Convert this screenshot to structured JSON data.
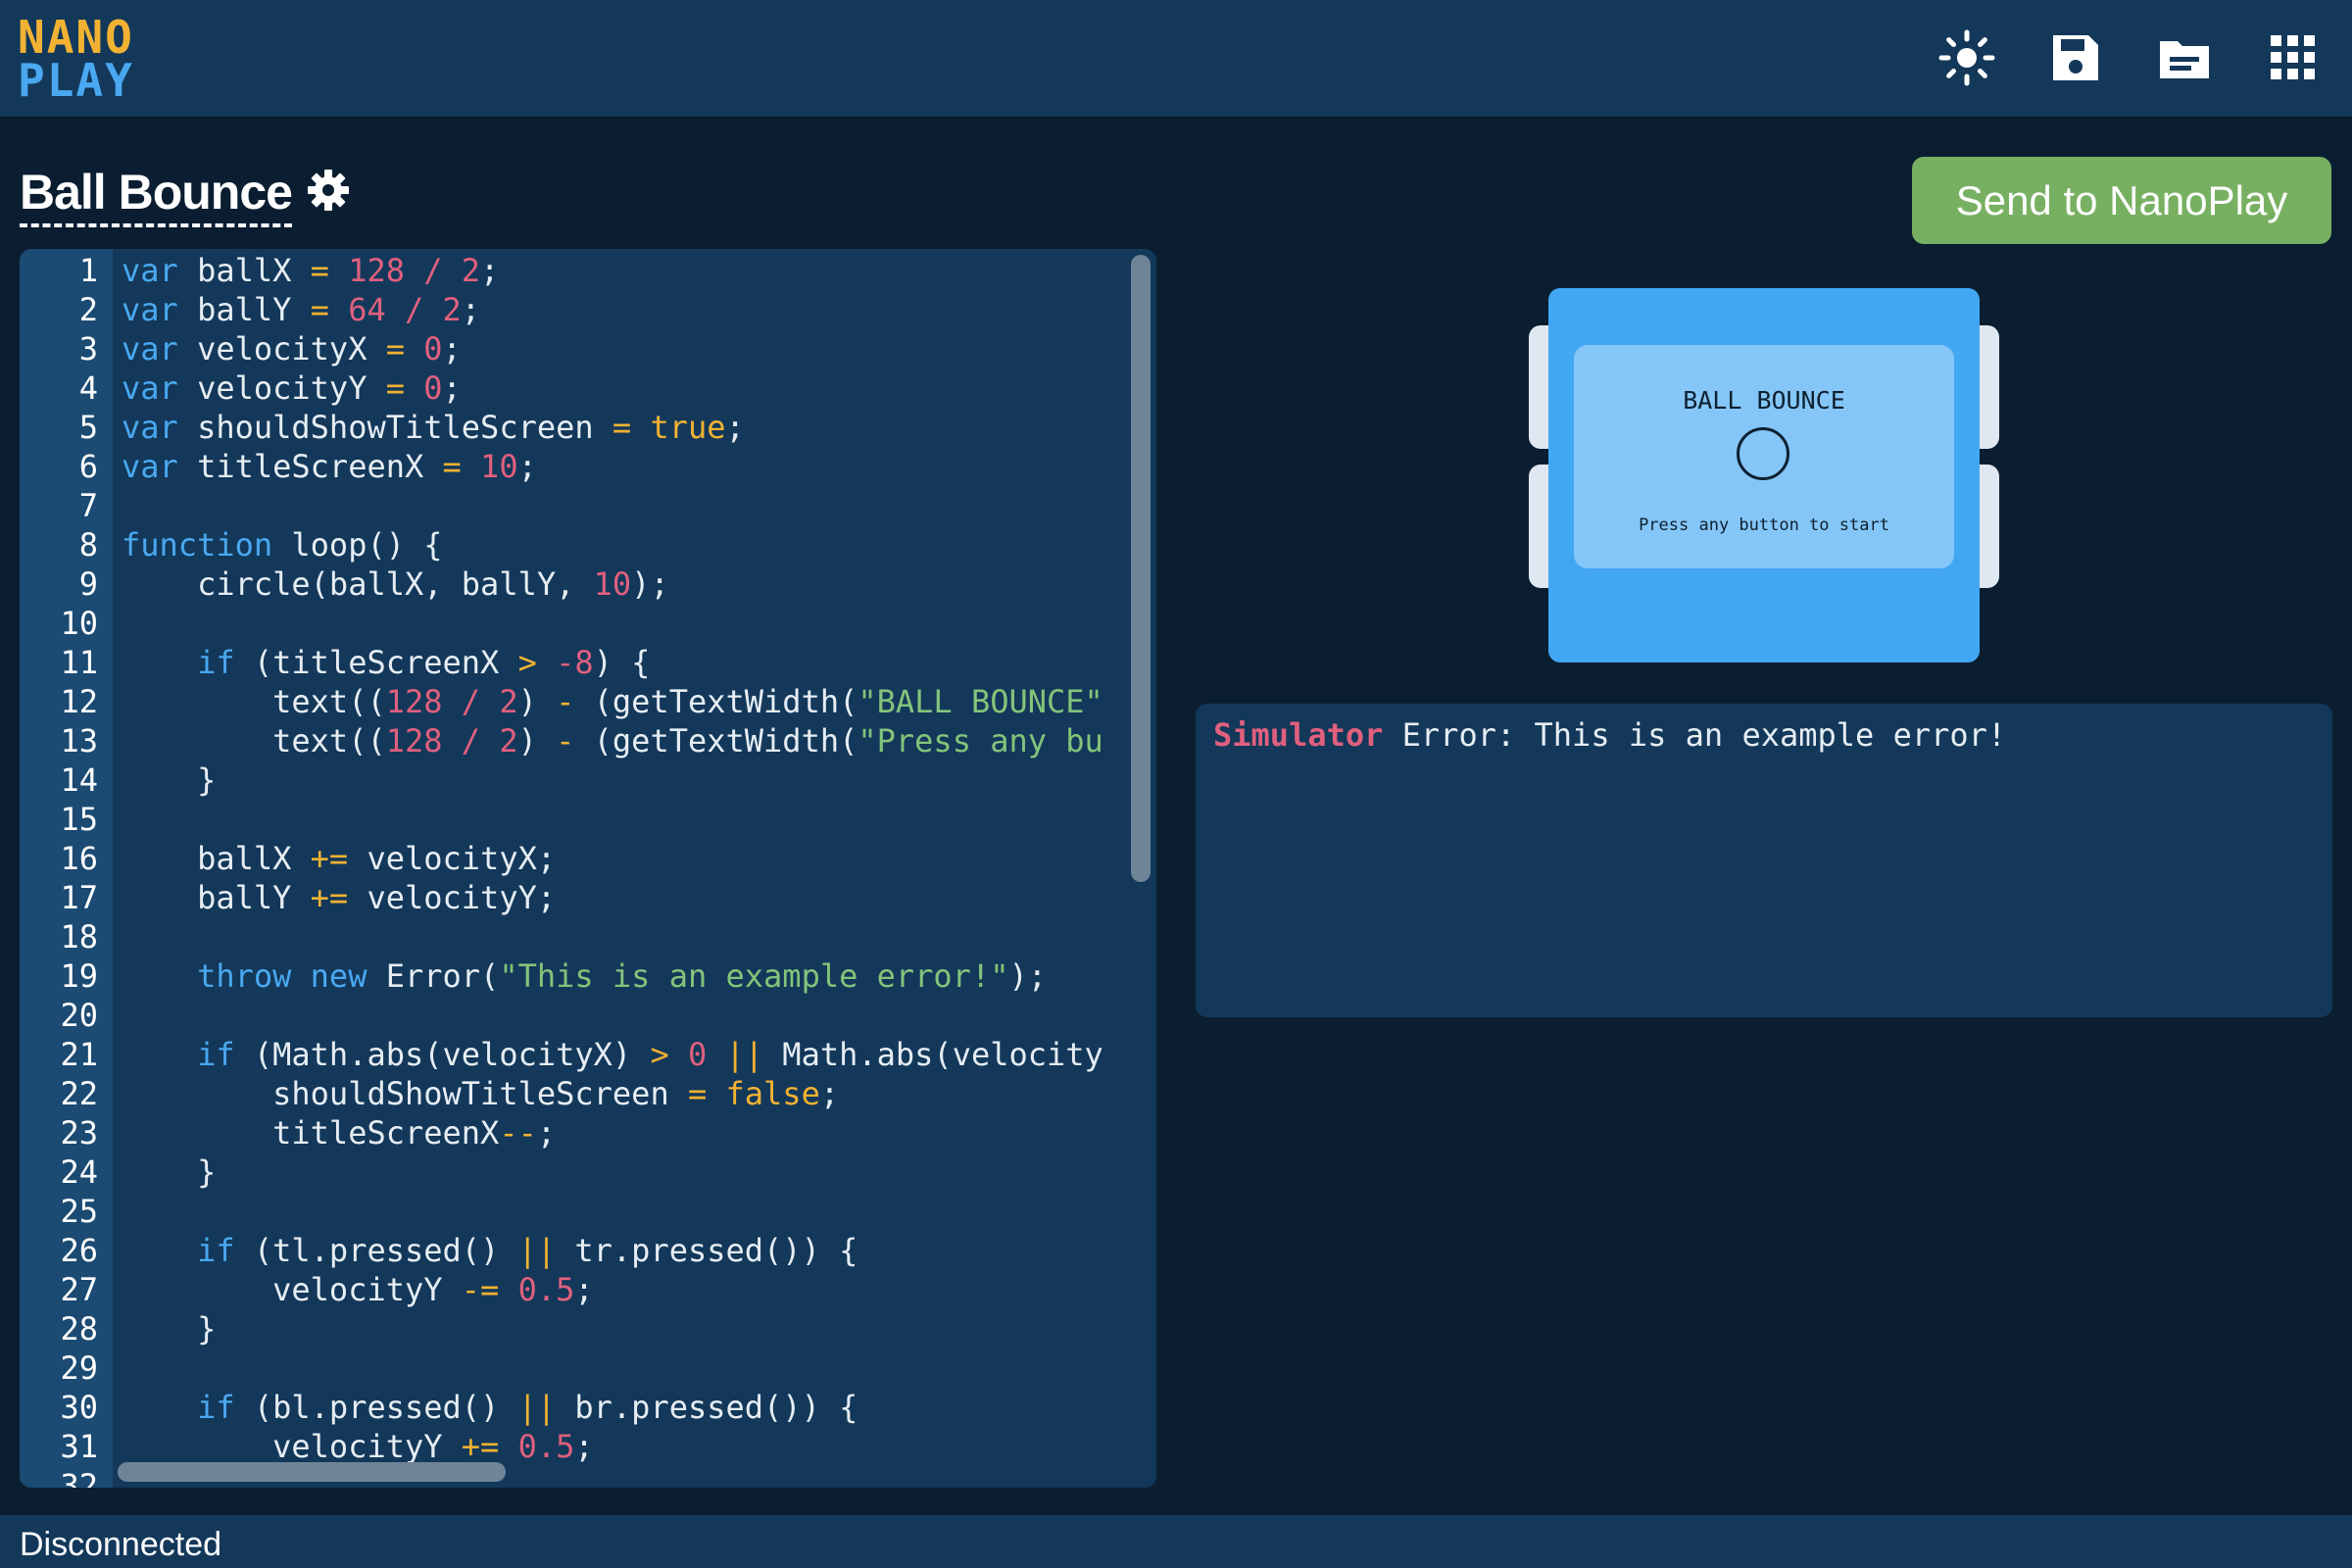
{
  "app": {
    "logo_line1": "NANO",
    "logo_line2": "PLAY",
    "toolbar_icons": [
      "sun-icon",
      "save-icon",
      "folder-icon",
      "grid-icon"
    ]
  },
  "project": {
    "title": "Ball Bounce",
    "send_button": "Send to NanoPlay"
  },
  "colors": {
    "background": "#0b1e31",
    "panel": "#13385a",
    "accent_blue": "#4aa8f0",
    "accent_orange": "#f2b233",
    "number_pink": "#e0607e",
    "string_green": "#83c47a",
    "send_green": "#78b062",
    "device_blue": "#42a7f2"
  },
  "editor": {
    "lines": [
      [
        [
          "kw",
          "var"
        ],
        [
          "t",
          " ballX "
        ],
        [
          "op",
          "="
        ],
        [
          "t",
          " "
        ],
        [
          "num",
          "128"
        ],
        [
          "t",
          " "
        ],
        [
          "num",
          "/"
        ],
        [
          "t",
          " "
        ],
        [
          "num",
          "2"
        ],
        [
          "t",
          ";"
        ]
      ],
      [
        [
          "kw",
          "var"
        ],
        [
          "t",
          " ballY "
        ],
        [
          "op",
          "="
        ],
        [
          "t",
          " "
        ],
        [
          "num",
          "64"
        ],
        [
          "t",
          " "
        ],
        [
          "num",
          "/"
        ],
        [
          "t",
          " "
        ],
        [
          "num",
          "2"
        ],
        [
          "t",
          ";"
        ]
      ],
      [
        [
          "kw",
          "var"
        ],
        [
          "t",
          " velocityX "
        ],
        [
          "op",
          "="
        ],
        [
          "t",
          " "
        ],
        [
          "num",
          "0"
        ],
        [
          "t",
          ";"
        ]
      ],
      [
        [
          "kw",
          "var"
        ],
        [
          "t",
          " velocityY "
        ],
        [
          "op",
          "="
        ],
        [
          "t",
          " "
        ],
        [
          "num",
          "0"
        ],
        [
          "t",
          ";"
        ]
      ],
      [
        [
          "kw",
          "var"
        ],
        [
          "t",
          " shouldShowTitleScreen "
        ],
        [
          "op",
          "="
        ],
        [
          "t",
          " "
        ],
        [
          "op",
          "true"
        ],
        [
          "t",
          ";"
        ]
      ],
      [
        [
          "kw",
          "var"
        ],
        [
          "t",
          " titleScreenX "
        ],
        [
          "op",
          "="
        ],
        [
          "t",
          " "
        ],
        [
          "num",
          "10"
        ],
        [
          "t",
          ";"
        ]
      ],
      [],
      [
        [
          "kw",
          "function"
        ],
        [
          "t",
          " loop() {"
        ]
      ],
      [
        [
          "t",
          "    circle(ballX, ballY, "
        ],
        [
          "num",
          "10"
        ],
        [
          "t",
          ");"
        ]
      ],
      [],
      [
        [
          "t",
          "    "
        ],
        [
          "kw",
          "if"
        ],
        [
          "t",
          " (titleScreenX "
        ],
        [
          "op",
          ">"
        ],
        [
          "t",
          " "
        ],
        [
          "num",
          "-8"
        ],
        [
          "t",
          ") {"
        ]
      ],
      [
        [
          "t",
          "        text(("
        ],
        [
          "num",
          "128"
        ],
        [
          "t",
          " "
        ],
        [
          "num",
          "/"
        ],
        [
          "t",
          " "
        ],
        [
          "num",
          "2"
        ],
        [
          "t",
          ") "
        ],
        [
          "op",
          "-"
        ],
        [
          "t",
          " (getTextWidth("
        ],
        [
          "str",
          "\"BALL BOUNCE\""
        ]
      ],
      [
        [
          "t",
          "        text(("
        ],
        [
          "num",
          "128"
        ],
        [
          "t",
          " "
        ],
        [
          "num",
          "/"
        ],
        [
          "t",
          " "
        ],
        [
          "num",
          "2"
        ],
        [
          "t",
          ") "
        ],
        [
          "op",
          "-"
        ],
        [
          "t",
          " (getTextWidth("
        ],
        [
          "str",
          "\"Press any bu"
        ]
      ],
      [
        [
          "t",
          "    }"
        ]
      ],
      [],
      [
        [
          "t",
          "    ballX "
        ],
        [
          "op",
          "+="
        ],
        [
          "t",
          " velocityX;"
        ]
      ],
      [
        [
          "t",
          "    ballY "
        ],
        [
          "op",
          "+="
        ],
        [
          "t",
          " velocityY;"
        ]
      ],
      [],
      [
        [
          "t",
          "    "
        ],
        [
          "kw",
          "throw"
        ],
        [
          "t",
          " "
        ],
        [
          "kw",
          "new"
        ],
        [
          "t",
          " Error("
        ],
        [
          "str",
          "\"This is an example error!\""
        ],
        [
          "t",
          ");"
        ]
      ],
      [],
      [
        [
          "t",
          "    "
        ],
        [
          "kw",
          "if"
        ],
        [
          "t",
          " (Math.abs(velocityX) "
        ],
        [
          "op",
          ">"
        ],
        [
          "t",
          " "
        ],
        [
          "num",
          "0"
        ],
        [
          "t",
          " "
        ],
        [
          "op",
          "||"
        ],
        [
          "t",
          " Math.abs(velocity"
        ]
      ],
      [
        [
          "t",
          "        shouldShowTitleScreen "
        ],
        [
          "op",
          "="
        ],
        [
          "t",
          " "
        ],
        [
          "op",
          "false"
        ],
        [
          "t",
          ";"
        ]
      ],
      [
        [
          "t",
          "        titleScreenX"
        ],
        [
          "op",
          "--"
        ],
        [
          "t",
          ";"
        ]
      ],
      [
        [
          "t",
          "    }"
        ]
      ],
      [],
      [
        [
          "t",
          "    "
        ],
        [
          "kw",
          "if"
        ],
        [
          "t",
          " (tl.pressed() "
        ],
        [
          "op",
          "||"
        ],
        [
          "t",
          " tr.pressed()) {"
        ]
      ],
      [
        [
          "t",
          "        velocityY "
        ],
        [
          "op",
          "-="
        ],
        [
          "t",
          " "
        ],
        [
          "num",
          "0.5"
        ],
        [
          "t",
          ";"
        ]
      ],
      [
        [
          "t",
          "    }"
        ]
      ],
      [],
      [
        [
          "t",
          "    "
        ],
        [
          "kw",
          "if"
        ],
        [
          "t",
          " (bl.pressed() "
        ],
        [
          "op",
          "||"
        ],
        [
          "t",
          " br.pressed()) {"
        ]
      ],
      [
        [
          "t",
          "        velocityY "
        ],
        [
          "op",
          "+="
        ],
        [
          "t",
          " "
        ],
        [
          "num",
          "0.5"
        ],
        [
          "t",
          ";"
        ]
      ],
      []
    ]
  },
  "simulator": {
    "screen_title": "BALL BOUNCE",
    "screen_subtitle": "Press any button to start"
  },
  "console": {
    "error_label": "Simulator",
    "error_message": " Error: This is an example error!"
  },
  "status": {
    "connection": "Disconnected"
  }
}
